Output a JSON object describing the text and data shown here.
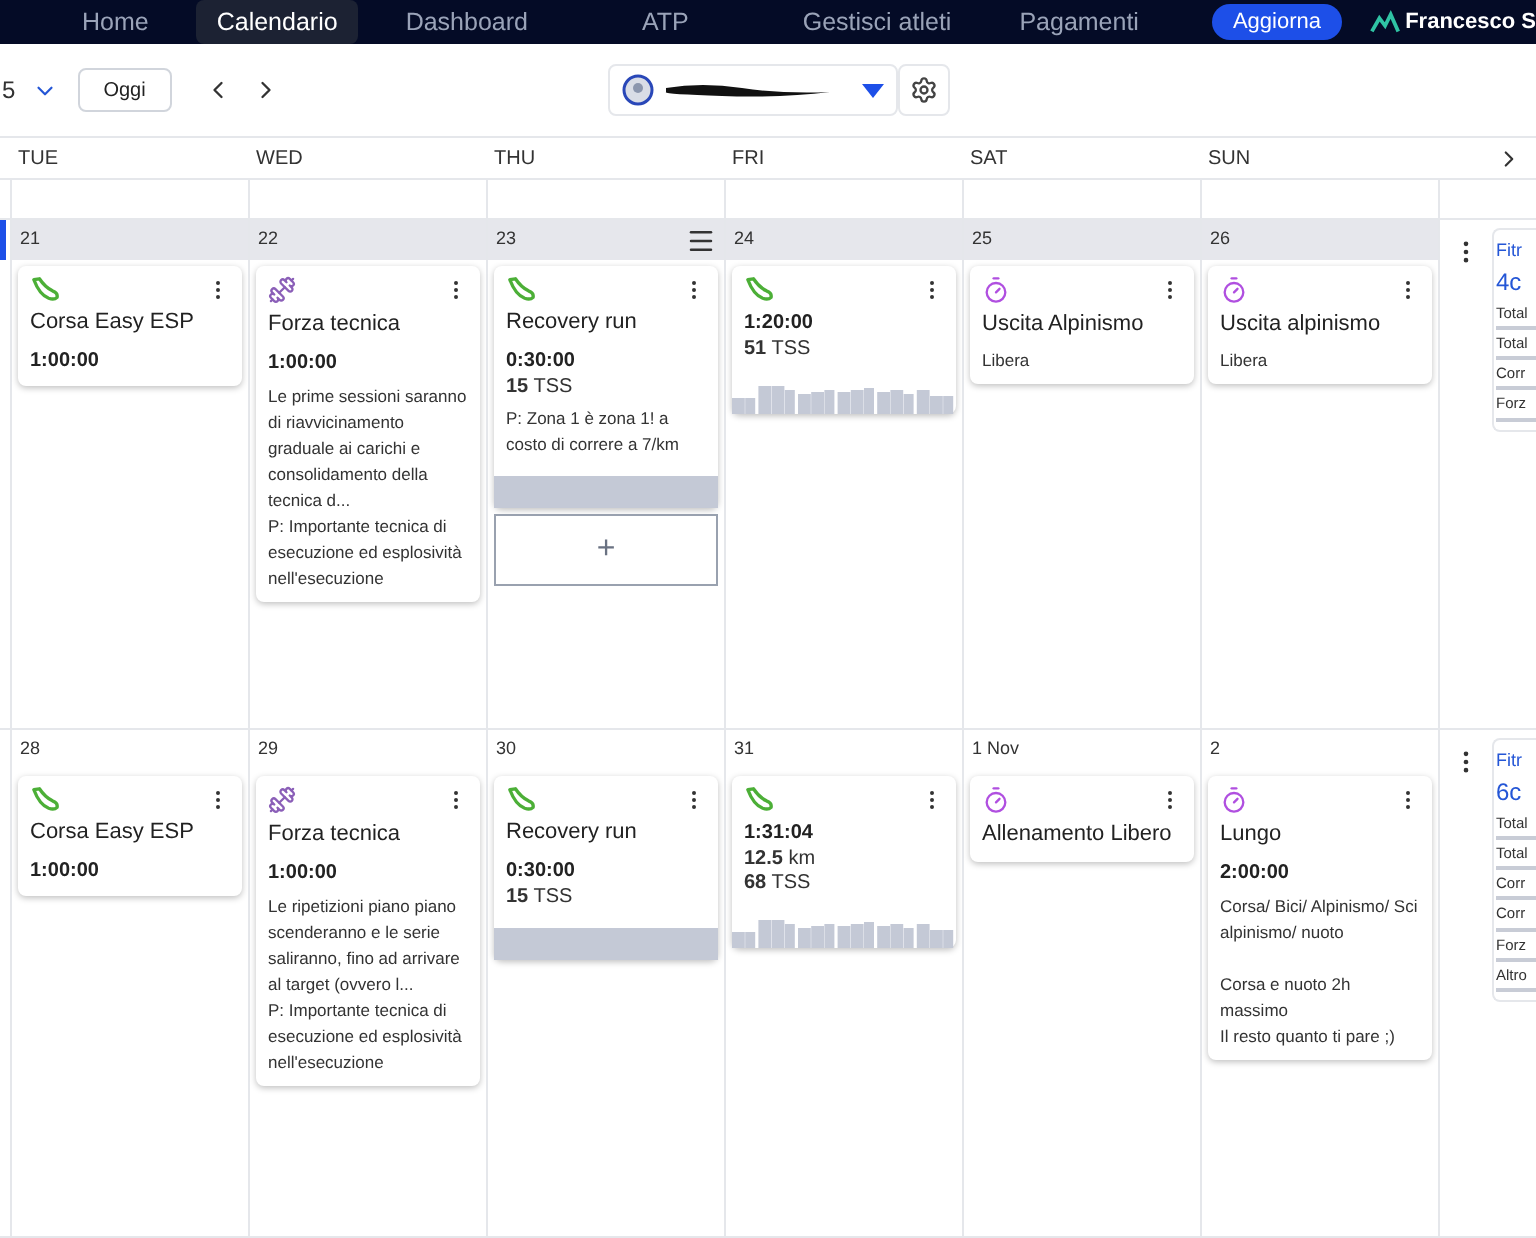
{
  "nav": {
    "items": [
      {
        "label": "Home",
        "selected": false
      },
      {
        "label": "Calendario",
        "selected": true
      },
      {
        "label": "Dashboard",
        "selected": false
      },
      {
        "label": "ATP",
        "selected": false
      },
      {
        "label": "Gestisci atleti",
        "selected": false
      },
      {
        "label": "Pagamenti",
        "selected": false
      }
    ],
    "update_button": "Aggiorna",
    "user": "Francesco S"
  },
  "toolbar": {
    "range_fragment": "5",
    "today_button": "Oggi"
  },
  "days": [
    "TUE",
    "WED",
    "THU",
    "FRI",
    "SAT",
    "SUN"
  ],
  "weeks": [
    {
      "current": true,
      "dates": [
        {
          "label": "21",
          "menu": false
        },
        {
          "label": "22",
          "menu": false
        },
        {
          "label": "23",
          "menu": true
        },
        {
          "label": "24",
          "menu": false
        },
        {
          "label": "25",
          "menu": false
        },
        {
          "label": "26",
          "menu": false
        }
      ],
      "days": [
        [
          {
            "kind": "run",
            "title": "Corsa Easy ESP",
            "duration": "1:00:00"
          }
        ],
        [
          {
            "kind": "strength",
            "title": "Forza tecnica",
            "duration": "1:00:00",
            "notes": [
              [
                "Le prime sessioni saranno di riavvicinamento graduale ai carichi e consolidamento della tecnica d...",
                "P: Importante tecnica di esecuzione ed esplosività nell'esecuzione"
              ]
            ]
          }
        ],
        [
          {
            "kind": "run",
            "title": "Recovery run",
            "duration": "0:30:00",
            "metrics": [
              "**15** TSS"
            ],
            "notes": [
              [
                "P: Zona 1 è zona 1! a costo di correre a 7/km"
              ]
            ],
            "intensity": {
              "kind": "flat"
            }
          },
          {
            "kind": "add",
            "label": "+"
          }
        ],
        [
          {
            "kind": "run",
            "duration": "1:20:00",
            "metrics": [
              "**51** TSS"
            ],
            "intensity": {
              "kind": "bars"
            }
          }
        ],
        [
          {
            "kind": "timer",
            "title": "Uscita Alpinismo",
            "notes": [
              [
                "Libera"
              ]
            ]
          }
        ],
        [
          {
            "kind": "timer",
            "title": "Uscita alpinismo",
            "notes": [
              [
                "Libera"
              ]
            ]
          }
        ]
      ],
      "summary": {
        "title": "Fitr",
        "value": "4c",
        "rows": [
          "Total",
          "Total",
          "Corr",
          "Forz"
        ]
      }
    },
    {
      "current": false,
      "dates": [
        {
          "label": "28",
          "menu": false
        },
        {
          "label": "29",
          "menu": false
        },
        {
          "label": "30",
          "menu": false
        },
        {
          "label": "31",
          "menu": false
        },
        {
          "label": "1 Nov",
          "menu": false
        },
        {
          "label": "2",
          "menu": false
        }
      ],
      "days": [
        [
          {
            "kind": "run",
            "title": "Corsa Easy ESP",
            "duration": "1:00:00"
          }
        ],
        [
          {
            "kind": "strength",
            "title": "Forza tecnica",
            "duration": "1:00:00",
            "notes": [
              [
                "Le ripetizioni piano piano scenderanno e le serie saliranno, fino ad arrivare al target (ovvero l...",
                "P: Importante tecnica di esecuzione ed esplosività nell'esecuzione"
              ]
            ]
          }
        ],
        [
          {
            "kind": "run",
            "title": "Recovery run",
            "duration": "0:30:00",
            "metrics": [
              "**15** TSS"
            ],
            "intensity": {
              "kind": "flat"
            }
          }
        ],
        [
          {
            "kind": "run",
            "duration": "1:31:04",
            "metrics": [
              "**12.5** km",
              "**68** TSS"
            ],
            "intensity": {
              "kind": "bars"
            }
          }
        ],
        [
          {
            "kind": "timer",
            "title": "Allenamento Libero"
          }
        ],
        [
          {
            "kind": "timer",
            "title": "Lungo",
            "duration": "2:00:00",
            "notes": [
              [
                "Corsa/ Bici/ Alpinismo/ Sci alpinismo/ nuoto"
              ],
              [
                "Corsa e nuoto 2h massimo",
                "Il resto quanto ti pare ;)"
              ]
            ]
          }
        ]
      ],
      "summary": {
        "title": "Fitr",
        "value": "6c",
        "rows": [
          "Total",
          "Total",
          "Corr",
          "Corr",
          "Forz",
          "Altro"
        ]
      }
    }
  ]
}
